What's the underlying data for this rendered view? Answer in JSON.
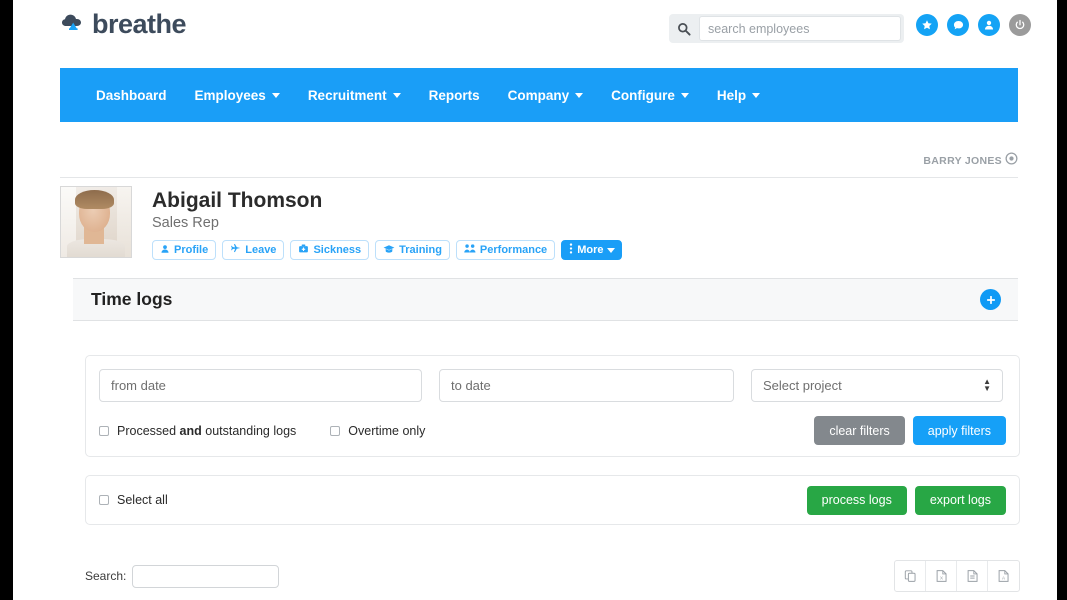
{
  "brand": {
    "name": "breathe",
    "logo_icon": "cloud-icon",
    "accent_blue": "#1a9ef7",
    "text_dark": "#3d4b5c"
  },
  "header": {
    "search": {
      "placeholder": "search employees",
      "value": "",
      "icon": "search-icon"
    },
    "icons": [
      {
        "name": "star-icon",
        "glyph": "★",
        "color": "#14a3f5"
      },
      {
        "name": "chat-bubble-icon",
        "glyph": "●",
        "color": "#14a3f5"
      },
      {
        "name": "user-account-icon",
        "glyph": "●",
        "color": "#14a3f5"
      },
      {
        "name": "power-icon",
        "glyph": "⏻",
        "color": "#9b9b9b"
      }
    ]
  },
  "nav": {
    "items": [
      {
        "label": "Dashboard",
        "has_dropdown": false
      },
      {
        "label": "Employees",
        "has_dropdown": true
      },
      {
        "label": "Recruitment",
        "has_dropdown": true
      },
      {
        "label": "Reports",
        "has_dropdown": false
      },
      {
        "label": "Company",
        "has_dropdown": true
      },
      {
        "label": "Configure",
        "has_dropdown": true
      },
      {
        "label": "Help",
        "has_dropdown": true
      }
    ]
  },
  "account": {
    "user_name": "BARRY JONES",
    "icon": "gear-circle-icon"
  },
  "profile": {
    "avatar_alt": "employee-photo",
    "name": "Abigail Thomson",
    "role": "Sales Rep",
    "tabs": [
      {
        "label": "Profile",
        "icon": "person-icon",
        "active": false
      },
      {
        "label": "Leave",
        "icon": "airplane-icon",
        "active": false
      },
      {
        "label": "Sickness",
        "icon": "medical-kit-icon",
        "active": false
      },
      {
        "label": "Training",
        "icon": "graduation-cap-icon",
        "active": false
      },
      {
        "label": "Performance",
        "icon": "performance-icon",
        "active": false
      },
      {
        "label": "More",
        "icon": "vertical-dots-icon",
        "active": true,
        "has_dropdown": true
      }
    ]
  },
  "section": {
    "title": "Time logs",
    "add_icon": "plus-circle-icon"
  },
  "filters": {
    "from_date": {
      "placeholder": "from date",
      "value": ""
    },
    "to_date": {
      "placeholder": "to date",
      "value": ""
    },
    "project": {
      "selected": "Select project",
      "options": [
        "Select project"
      ]
    },
    "processed_checkbox": {
      "prefix": "Processed ",
      "bold": "and",
      "suffix": " outstanding logs",
      "checked": false
    },
    "overtime_checkbox": {
      "label": "Overtime only",
      "checked": false
    },
    "clear_button": "clear filters",
    "apply_button": "apply filters"
  },
  "logs_toolbar": {
    "select_all_label": "Select all",
    "select_all_checked": false,
    "process_button": "process logs",
    "export_button": "export logs"
  },
  "table_controls": {
    "search_label": "Search:",
    "search_value": "",
    "export_icons": [
      {
        "name": "copy-icon"
      },
      {
        "name": "excel-export-icon"
      },
      {
        "name": "csv-export-icon"
      },
      {
        "name": "pdf-export-icon"
      }
    ]
  }
}
